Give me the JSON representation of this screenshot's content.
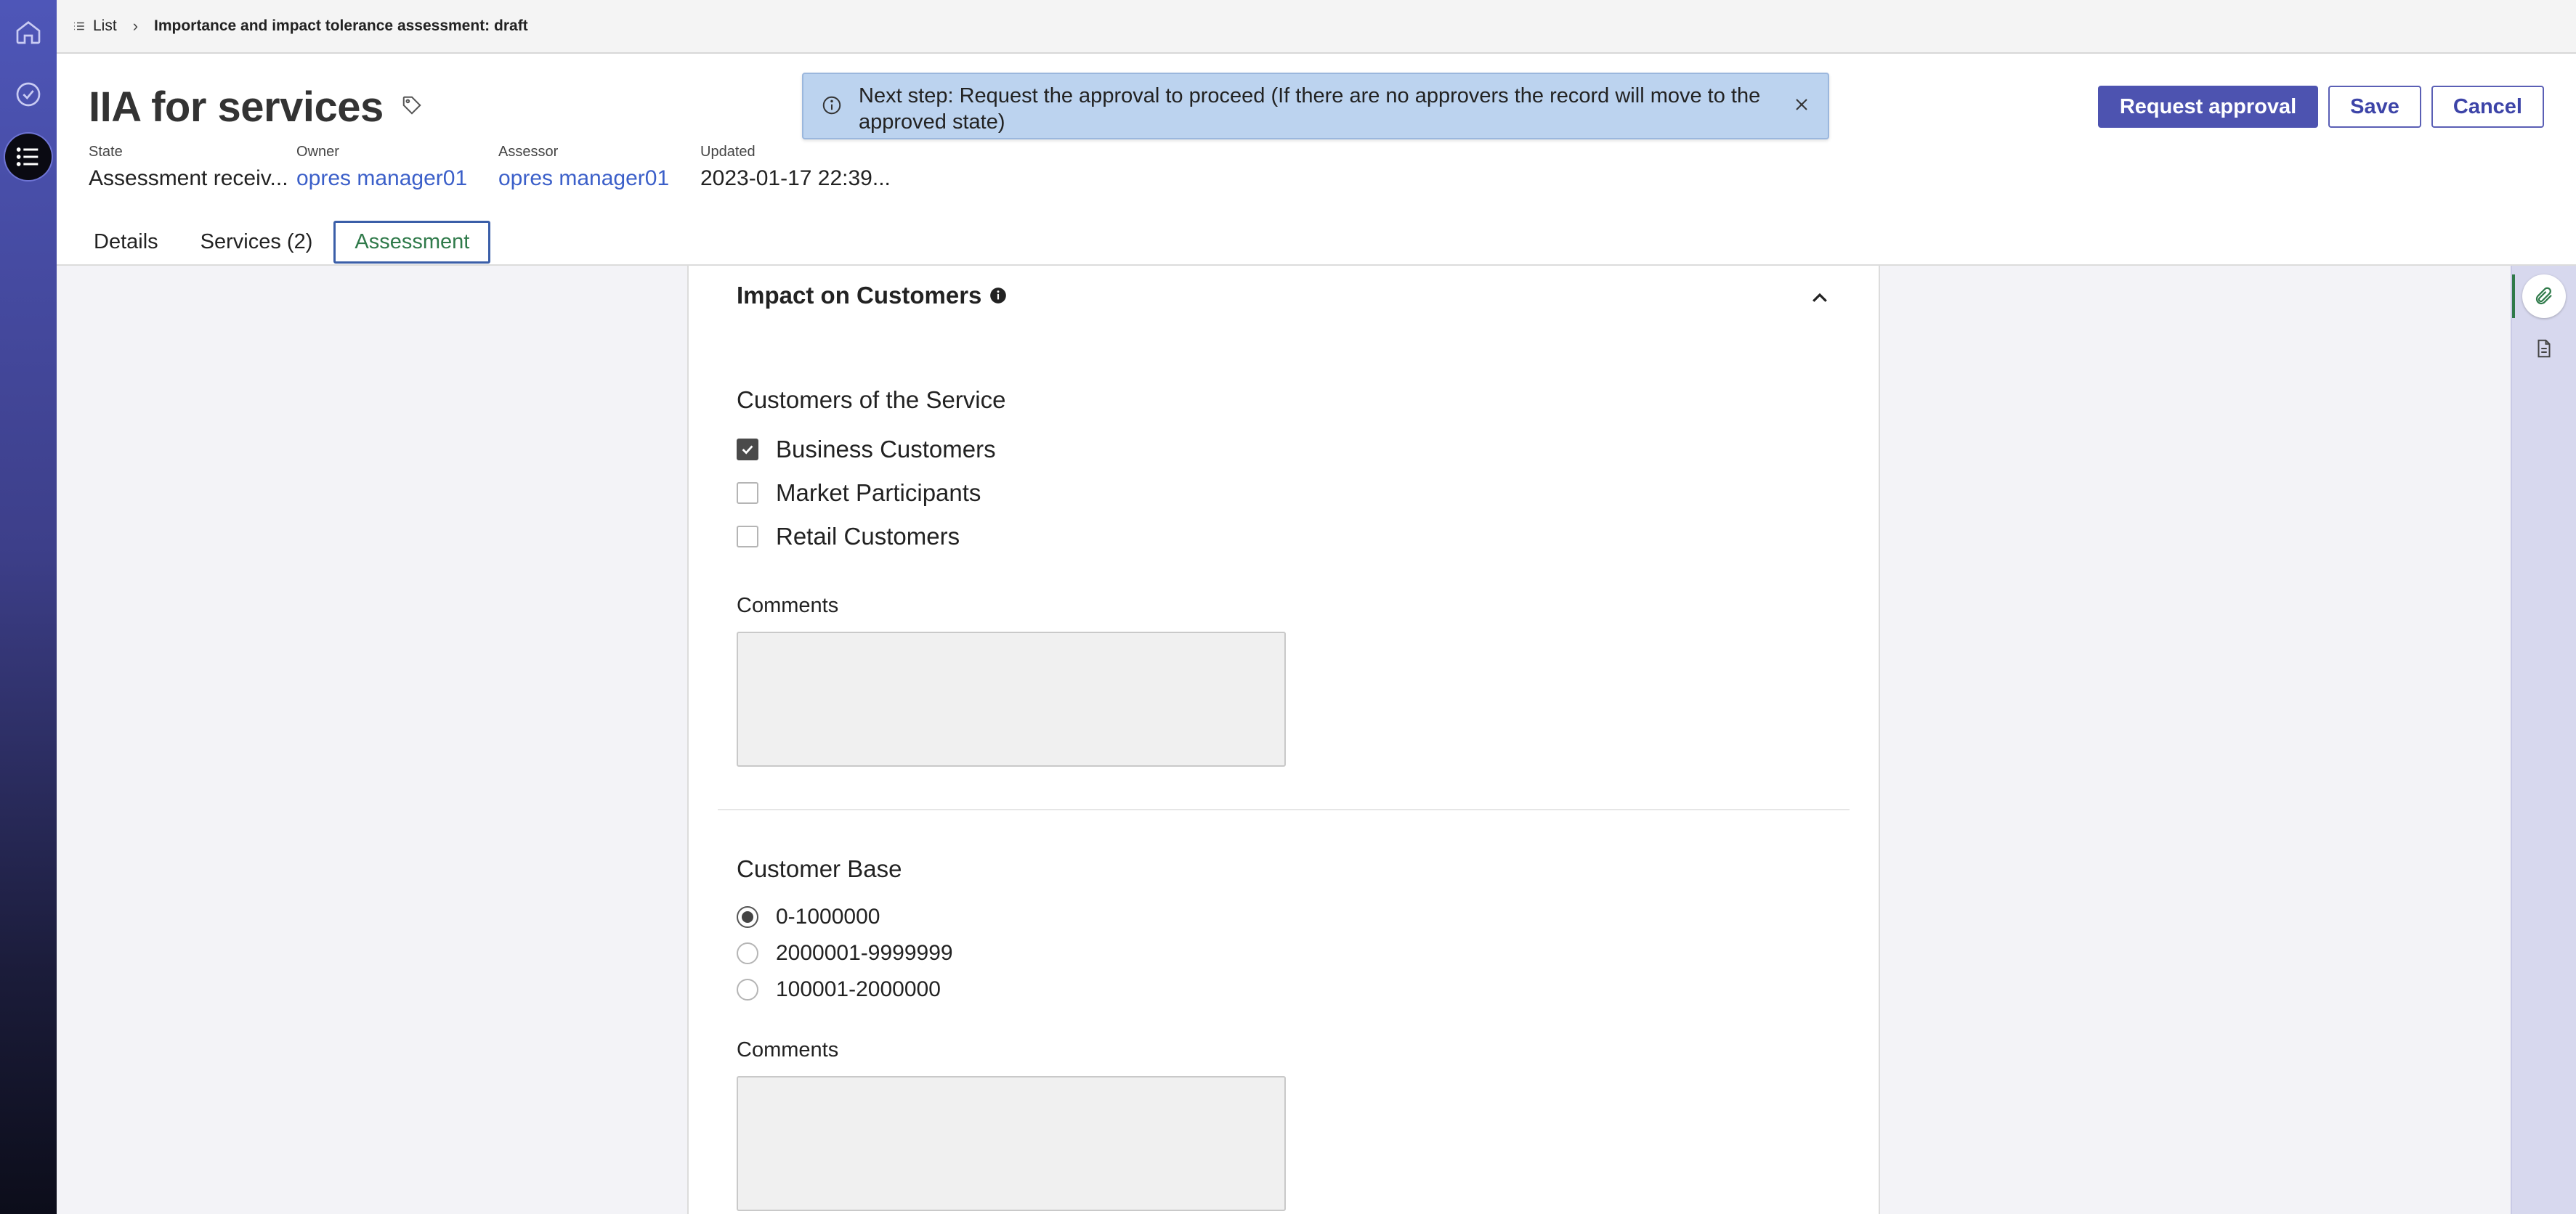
{
  "breadcrumb": {
    "list_label": "List",
    "current": "Importance and impact tolerance assessment: draft"
  },
  "header": {
    "title": "IIA for services",
    "meta": [
      {
        "label": "State",
        "value": "Assessment receiv...",
        "link": false
      },
      {
        "label": "Owner",
        "value": "opres manager01",
        "link": true
      },
      {
        "label": "Assessor",
        "value": "opres manager01",
        "link": true
      },
      {
        "label": "Updated",
        "value": "2023-01-17 22:39...",
        "link": false
      }
    ],
    "tabs": [
      {
        "label": "Details",
        "active": false
      },
      {
        "label": "Services (2)",
        "active": false
      },
      {
        "label": "Assessment",
        "active": true
      }
    ],
    "actions": {
      "request_approval": "Request approval",
      "save": "Save",
      "cancel": "Cancel"
    }
  },
  "toast": {
    "message": "Next step: Request the approval to proceed (If there are no approvers the record will move to the approved state)"
  },
  "section": {
    "title": "Impact on Customers",
    "customers": {
      "title": "Customers of the Service",
      "options": [
        {
          "label": "Business Customers",
          "checked": true
        },
        {
          "label": "Market Participants",
          "checked": false
        },
        {
          "label": "Retail Customers",
          "checked": false
        }
      ],
      "comments_label": "Comments",
      "comments_value": ""
    },
    "customer_base": {
      "title": "Customer Base",
      "options": [
        {
          "label": "0-1000000",
          "selected": true
        },
        {
          "label": "2000001-9999999",
          "selected": false
        },
        {
          "label": "100001-2000000",
          "selected": false
        }
      ],
      "comments_label": "Comments",
      "comments_value": ""
    }
  },
  "colors": {
    "accent": "#4d53b0",
    "link": "#3b5fc9",
    "active_tab_text": "#2f7a4a",
    "toast_bg": "#bcd3ef"
  }
}
